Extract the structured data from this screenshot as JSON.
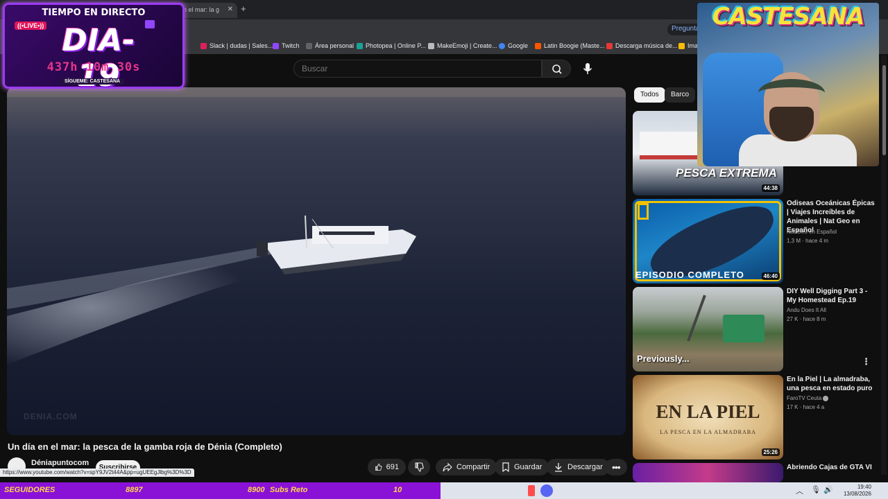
{
  "browser": {
    "tab_title": "n el mar: la g",
    "ask_button": "Pregunta",
    "bookmarks": [
      "Slack | dudas | Sales...",
      "Twitch",
      "Área personal",
      "Photopea | Online P...",
      "MakeEmoji | Create...",
      "Google",
      "Latin Boogie (Maste...",
      "Descarga música de...",
      "Ima"
    ],
    "status_url": "https://www.youtube.com/watch?v=spY9JV2t44A&pp=ugUEEgJlbg%3D%3D"
  },
  "search": {
    "placeholder": "Buscar"
  },
  "video": {
    "title": "Un día en el mar: la pesca de la gamba roja de Dénia (Completo)",
    "channel": "Déniapuntocom",
    "subscribe": "Suscribirse",
    "watermark": "DENIA.COM"
  },
  "actions": {
    "likes": "691",
    "share": "Compartir",
    "save": "Guardar",
    "download": "Descargar"
  },
  "chips": [
    "Todos",
    "Barco"
  ],
  "sidebar": [
    {
      "thumb_text": "PESCA EXTREMA",
      "duration": "44:38",
      "title": "",
      "channel": "",
      "meta": ""
    },
    {
      "thumb_text": "EPISODIO COMPLETO",
      "duration": "46:40",
      "title": "Odiseas Oceánicas Épicas | Viajes Increíbles de Animales | Nat Geo en Español",
      "channel": "Nat Geo en Español",
      "meta": "1,3 M · hace 4 m"
    },
    {
      "thumb_text": "Previously...",
      "duration": "",
      "title": "DIY Well Digging Part 3 - My Homestead Ep.19",
      "channel": "Andu Does It All",
      "meta": "27 K · hace 8 m"
    },
    {
      "thumb_text": "EN LA PIEL",
      "thumb_sub": "LA PESCA EN LA ALMADRABA",
      "duration": "25:26",
      "title": "En la Piel | La almadraba, una pesca en estado puro",
      "channel": "FaroTV Ceuta",
      "meta": "17 K · hace 4 a"
    },
    {
      "thumb_text": "",
      "duration": "",
      "title": "Abriendo Cajas de GTA VI",
      "channel": "",
      "meta": ""
    }
  ],
  "overlay": {
    "header": "TIEMPO EN DIRECTO",
    "live": "((•LIVE•))",
    "day": "DIA-19",
    "timer": "437h 10m 30s",
    "follow": "SÍGUEME: CASTESANA",
    "streamer_logo": "CASTESANA"
  },
  "ticker": {
    "followers_label": "SEGUIDORES",
    "followers_value": "8897",
    "subs_total": "8900",
    "subs_label": "Subs Reto",
    "subs_value": "10"
  },
  "taskbar": {
    "time": "19:40",
    "date": "13/08/2026"
  },
  "colors": {
    "accent": "#8a12d6",
    "ticker_text": "#ffd84a",
    "overlay_border": "#9b3df0"
  }
}
